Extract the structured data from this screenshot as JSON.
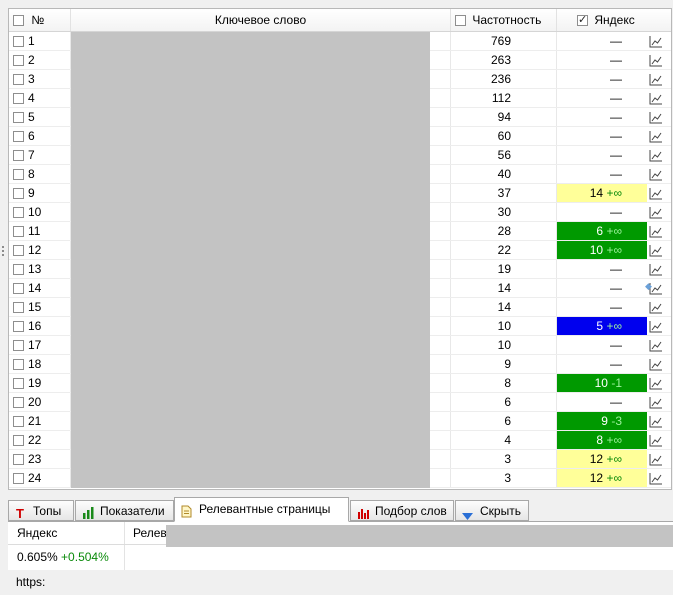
{
  "grid": {
    "headers": {
      "num": "№",
      "keyword": "Ключевое слово",
      "frequency": "Частотность",
      "yandex": "Яндекс"
    },
    "header_checks": {
      "num": false,
      "frequency": false,
      "yandex": true
    },
    "rows": [
      {
        "num": "1",
        "freq": "769",
        "pos": "—",
        "delta": "",
        "style": "none"
      },
      {
        "num": "2",
        "freq": "263",
        "pos": "—",
        "delta": "",
        "style": "none"
      },
      {
        "num": "3",
        "freq": "236",
        "pos": "—",
        "delta": "",
        "style": "none"
      },
      {
        "num": "4",
        "freq": "112",
        "pos": "—",
        "delta": "",
        "style": "none"
      },
      {
        "num": "5",
        "freq": "94",
        "pos": "—",
        "delta": "",
        "style": "none"
      },
      {
        "num": "6",
        "freq": "60",
        "pos": "—",
        "delta": "",
        "style": "none"
      },
      {
        "num": "7",
        "freq": "56",
        "pos": "—",
        "delta": "",
        "style": "none"
      },
      {
        "num": "8",
        "freq": "40",
        "pos": "—",
        "delta": "",
        "style": "none"
      },
      {
        "num": "9",
        "freq": "37",
        "pos": "14",
        "delta": "+∞",
        "style": "yellow"
      },
      {
        "num": "10",
        "freq": "30",
        "pos": "—",
        "delta": "",
        "style": "none"
      },
      {
        "num": "11",
        "freq": "28",
        "pos": "6",
        "delta": "+∞",
        "style": "green"
      },
      {
        "num": "12",
        "freq": "22",
        "pos": "10",
        "delta": "+∞",
        "style": "green"
      },
      {
        "num": "13",
        "freq": "19",
        "pos": "—",
        "delta": "",
        "style": "none"
      },
      {
        "num": "14",
        "freq": "14",
        "pos": "—",
        "delta": "",
        "style": "none"
      },
      {
        "num": "15",
        "freq": "14",
        "pos": "—",
        "delta": "",
        "style": "none"
      },
      {
        "num": "16",
        "freq": "10",
        "pos": "5",
        "delta": "+∞",
        "style": "blue"
      },
      {
        "num": "17",
        "freq": "10",
        "pos": "—",
        "delta": "",
        "style": "none"
      },
      {
        "num": "18",
        "freq": "9",
        "pos": "—",
        "delta": "",
        "style": "none"
      },
      {
        "num": "19",
        "freq": "8",
        "pos": "10",
        "delta": "-1",
        "style": "green"
      },
      {
        "num": "20",
        "freq": "6",
        "pos": "—",
        "delta": "",
        "style": "none"
      },
      {
        "num": "21",
        "freq": "6",
        "pos": "9",
        "delta": "-3",
        "style": "green"
      },
      {
        "num": "22",
        "freq": "4",
        "pos": "8",
        "delta": "+∞",
        "style": "green"
      },
      {
        "num": "23",
        "freq": "3",
        "pos": "12",
        "delta": "+∞",
        "style": "yellow"
      },
      {
        "num": "24",
        "freq": "3",
        "pos": "12",
        "delta": "+∞",
        "style": "yellow"
      }
    ]
  },
  "tabs": [
    {
      "label": "Топы",
      "icon": "top-icon",
      "active": false
    },
    {
      "label": "Показатели",
      "icon": "bar-chart-icon",
      "active": false
    },
    {
      "label": "Релевантные страницы",
      "icon": "document-icon",
      "active": true
    },
    {
      "label": "Подбор слов",
      "icon": "bar-chart-red-icon",
      "active": false
    },
    {
      "label": "Скрыть",
      "icon": "triangle-down-icon",
      "active": false
    }
  ],
  "panel": {
    "col_yandex": "Яндекс",
    "col_page": "Релевантная страница",
    "value": "0.605%",
    "change": "+0.504%",
    "url_prefix": "https:"
  },
  "colors": {
    "yellow": "#ffff99",
    "green": "#009900",
    "blue": "#0000ee"
  }
}
